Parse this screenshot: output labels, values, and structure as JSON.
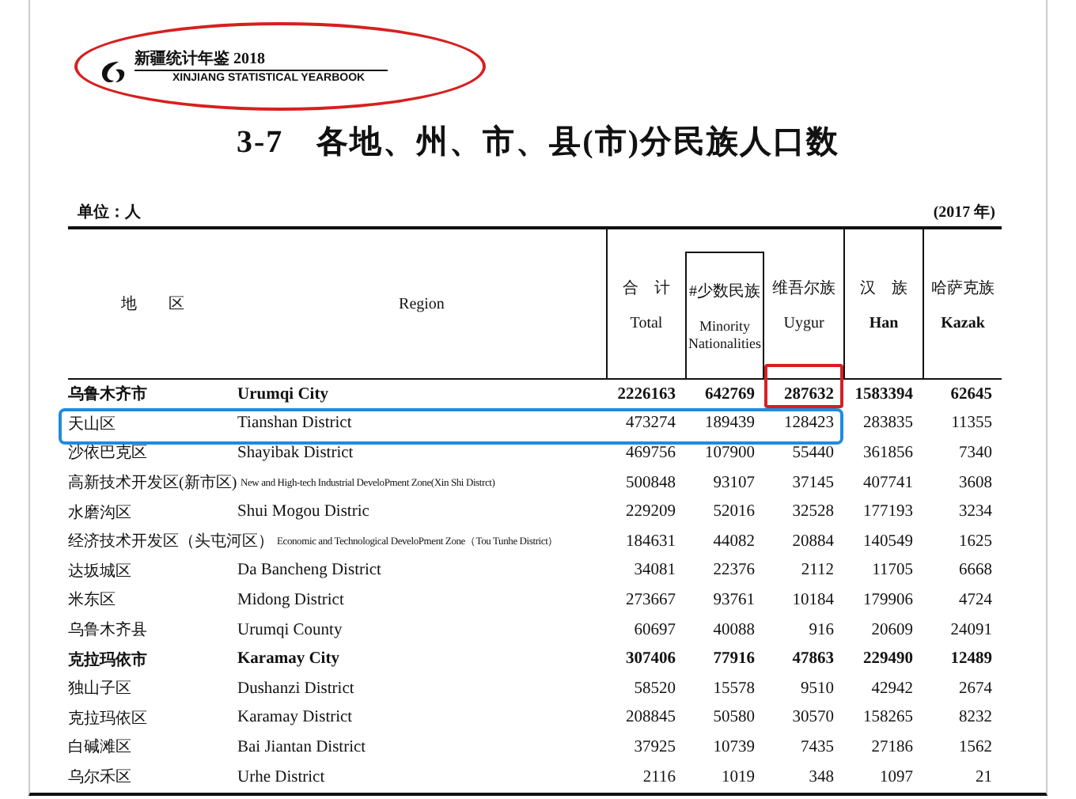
{
  "logo": {
    "title_cn": "新疆统计年鉴 2018",
    "title_en": "XINJIANG STATISTICAL YEARBOOK",
    "circled": true
  },
  "table_title": "3-7　各地、州、市、县(市)分民族人口数",
  "unit": "单位：人",
  "year": "(2017 年)",
  "header": {
    "region_cn": "地　　区",
    "region_en": "Region",
    "columns": [
      {
        "cn": "合　计",
        "en": "Total",
        "bracketed": false
      },
      {
        "cn": "#少数民族",
        "en": "Minority Nationalities",
        "bracketed": true
      },
      {
        "cn": "维吾尔族",
        "en": "Uygur",
        "bracketed": false
      },
      {
        "cn": "汉　族",
        "en": "Han",
        "bracketed": false
      },
      {
        "cn": "哈萨克族",
        "en": "Kazak",
        "bracketed": false
      }
    ]
  },
  "rows": [
    {
      "cn": "乌鲁木齐市",
      "en": "Urumqi City",
      "values": [
        "2226163",
        "642769",
        "287632",
        "1583394",
        "62645"
      ],
      "marked": [
        false,
        false,
        true,
        false,
        false
      ],
      "bold": true,
      "outlined": false
    },
    {
      "cn": "天山区",
      "en": "Tianshan District",
      "values": [
        "473274",
        "189439",
        "128423",
        "283835",
        "11355"
      ],
      "marked": [
        false,
        false,
        false,
        false,
        false
      ],
      "bold": false,
      "outlined": true
    },
    {
      "cn": "沙依巴克区",
      "en": "Shayibak District",
      "values": [
        "469756",
        "107900",
        "55440",
        "361856",
        "7340"
      ],
      "marked": [
        false,
        false,
        false,
        false,
        false
      ],
      "bold": false,
      "outlined": false
    },
    {
      "cn": "高新技术开发区(新市区)",
      "en": "New and High-tech Industrial DeveloPment Zone(Xin Shi Distrct)",
      "values": [
        "500848",
        "93107",
        "37145",
        "407741",
        "3608"
      ],
      "marked": [
        false,
        false,
        false,
        false,
        false
      ],
      "bold": false,
      "outlined": false
    },
    {
      "cn": "水磨沟区",
      "en": "Shui Mogou Distric",
      "values": [
        "229209",
        "52016",
        "32528",
        "177193",
        "3234"
      ],
      "marked": [
        false,
        false,
        false,
        false,
        false
      ],
      "bold": false,
      "outlined": false
    },
    {
      "cn": "经济技术开发区（头屯河区）",
      "en": "Economic and Technological DeveloPment Zone（Tou Tunhe District）",
      "values": [
        "184631",
        "44082",
        "20884",
        "140549",
        "1625"
      ],
      "marked": [
        false,
        false,
        false,
        false,
        false
      ],
      "bold": false,
      "outlined": false
    },
    {
      "cn": "达坂城区",
      "en": "Da Bancheng District",
      "values": [
        "34081",
        "22376",
        "2112",
        "11705",
        "6668"
      ],
      "marked": [
        false,
        false,
        false,
        false,
        false
      ],
      "bold": false,
      "outlined": false
    },
    {
      "cn": "米东区",
      "en": "Midong District",
      "values": [
        "273667",
        "93761",
        "10184",
        "179906",
        "4724"
      ],
      "marked": [
        false,
        false,
        false,
        false,
        false
      ],
      "bold": false,
      "outlined": false
    },
    {
      "cn": "乌鲁木齐县",
      "en": "Urumqi County",
      "values": [
        "60697",
        "40088",
        "916",
        "20609",
        "24091"
      ],
      "marked": [
        false,
        false,
        false,
        false,
        false
      ],
      "bold": false,
      "outlined": false
    },
    {
      "cn": "克拉玛依市",
      "en": "Karamay City",
      "values": [
        "307406",
        "77916",
        "47863",
        "229490",
        "12489"
      ],
      "marked": [
        false,
        false,
        false,
        false,
        false
      ],
      "bold": true,
      "outlined": false
    },
    {
      "cn": "独山子区",
      "en": "Dushanzi District",
      "values": [
        "58520",
        "15578",
        "9510",
        "42942",
        "2674"
      ],
      "marked": [
        false,
        false,
        false,
        false,
        false
      ],
      "bold": false,
      "outlined": false
    },
    {
      "cn": "克拉玛依区",
      "en": "Karamay District",
      "values": [
        "208845",
        "50580",
        "30570",
        "158265",
        "8232"
      ],
      "marked": [
        false,
        false,
        false,
        false,
        false
      ],
      "bold": false,
      "outlined": false
    },
    {
      "cn": "白碱滩区",
      "en": "Bai Jiantan District",
      "values": [
        "37925",
        "10739",
        "7435",
        "27186",
        "1562"
      ],
      "marked": [
        false,
        false,
        false,
        false,
        false
      ],
      "bold": false,
      "outlined": false
    },
    {
      "cn": "乌尔禾区",
      "en": "Urhe District",
      "values": [
        "2116",
        "1019",
        "348",
        "1097",
        "21"
      ],
      "marked": [
        false,
        false,
        false,
        false,
        false
      ],
      "bold": false,
      "outlined": false
    }
  ]
}
